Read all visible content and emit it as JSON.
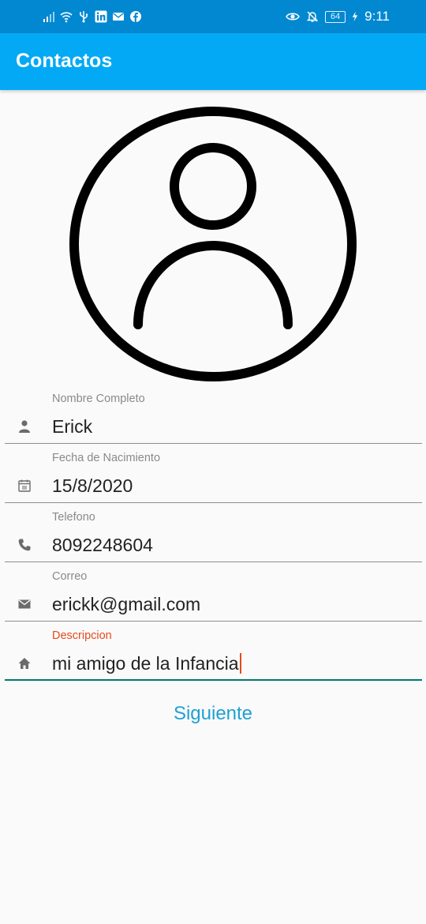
{
  "status_bar": {
    "time": "9:11",
    "battery": "64",
    "left_icons": [
      "signal-icon",
      "wifi-icon",
      "usb-icon",
      "linkedin-icon",
      "mail-icon",
      "facebook-icon"
    ],
    "right_icons": [
      "eye-icon",
      "bell-off-icon",
      "battery-icon",
      "charging-icon"
    ]
  },
  "app_bar": {
    "title": "Contactos",
    "color": "#03a9f4"
  },
  "avatar": {
    "icon": "person-icon"
  },
  "form": {
    "fields": [
      {
        "label": "Nombre Completo",
        "value": "Erick",
        "icon": "person-icon"
      },
      {
        "label": "Fecha de Nacimiento",
        "value": "15/8/2020",
        "icon": "calendar-icon"
      },
      {
        "label": "Telefono",
        "value": "8092248604",
        "icon": "phone-icon"
      },
      {
        "label": "Correo",
        "value": "erickk@gmail.com",
        "icon": "email-icon"
      },
      {
        "label": "Descripcion",
        "value": "mi amigo de la Infancia",
        "icon": "home-icon",
        "focused": true
      }
    ],
    "accent_color": "#e64a19",
    "focus_line_color": "#00796b"
  },
  "actions": {
    "next_label": "Siguiente"
  }
}
